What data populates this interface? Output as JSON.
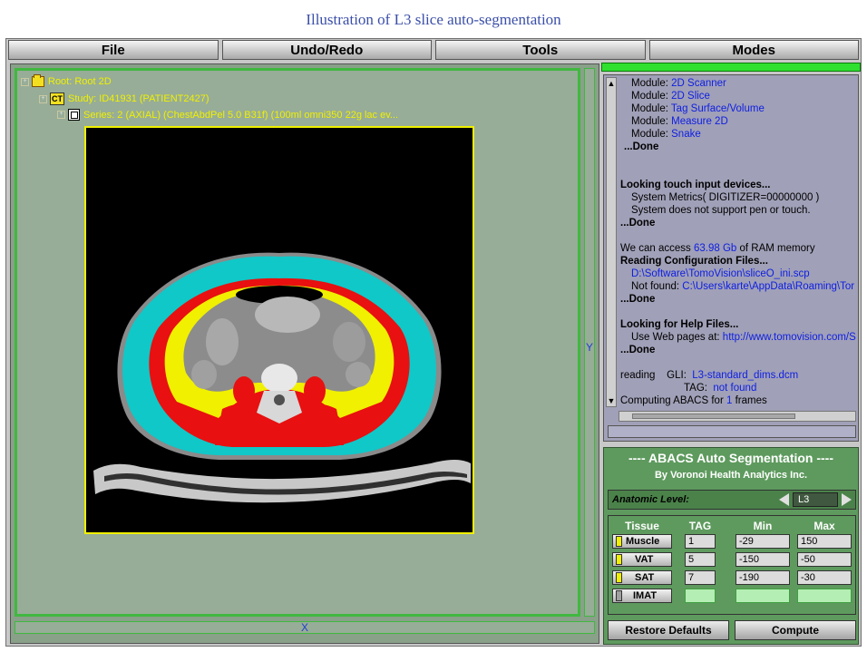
{
  "caption": "Illustration of L3 slice auto-segmentation",
  "menu": {
    "file": "File",
    "undo_redo": "Undo/Redo",
    "tools": "Tools",
    "modes": "Modes"
  },
  "tree": {
    "root": "Root: Root 2D",
    "study": "Study: ID41931 (PATIENT2427)",
    "study_icon": "CT",
    "series": "Series: 2 (AXIAL) (ChestAbdPel  5.0  B31f) (100ml omni350 22g lac ev..."
  },
  "axes": {
    "y": "Y",
    "x": "X"
  },
  "console": {
    "modules": [
      {
        "prefix": "Module:",
        "name": "2D Scanner"
      },
      {
        "prefix": "Module:",
        "name": "2D Slice"
      },
      {
        "prefix": "Module:",
        "name": "Tag Surface/Volume"
      },
      {
        "prefix": "Module:",
        "name": "Measure 2D"
      },
      {
        "prefix": "Module:",
        "name": "Snake"
      }
    ],
    "done": "...Done",
    "touch_header": "Looking touch input devices...",
    "touch_line1": "System Metrics( DIGITIZER=00000000 )",
    "touch_line2": "System does not support pen or touch.",
    "ram_prefix": "We can access",
    "ram_value": "63.98 Gb",
    "ram_suffix": "of RAM memory",
    "config_header": "Reading Configuration Files...",
    "config_path": "D:\\Software\\TomoVision\\sliceO_ini.scp",
    "notfound_prefix": "Not found:",
    "notfound_path": "C:\\Users\\karte\\AppData\\Roaming\\Tor",
    "help_header": "Looking for Help Files...",
    "help_prefix": "Use Web pages at:",
    "help_url": "http://www.tomovision.com/S",
    "reading_label": "reading",
    "gli_label": "GLI:",
    "gli_value": "L3-standard_dims.dcm",
    "tag_label": "TAG:",
    "tag_value": "not found",
    "computing_prefix": "Computing ABACS for",
    "computing_count": "1",
    "computing_suffix": "frames"
  },
  "abacs": {
    "title": "---- ABACS Auto Segmentation ----",
    "subtitle": "By Voronoi Health Analytics Inc.",
    "anatomic_label": "Anatomic Level:",
    "anatomic_value": "L3",
    "headers": {
      "tissue": "Tissue",
      "tag": "TAG",
      "min": "Min",
      "max": "Max"
    },
    "rows": [
      {
        "tissue": "Muscle",
        "tag": "1",
        "min": "-29",
        "max": "150",
        "color": "#f0f000"
      },
      {
        "tissue": "VAT",
        "tag": "5",
        "min": "-150",
        "max": "-50",
        "color": "#f0f000"
      },
      {
        "tissue": "SAT",
        "tag": "7",
        "min": "-190",
        "max": "-30",
        "color": "#f0f000"
      },
      {
        "tissue": "IMAT",
        "tag": "",
        "min": "",
        "max": "",
        "color": "#a0a0a0"
      }
    ],
    "restore_label": "Restore Defaults",
    "compute_label": "Compute"
  },
  "colors": {
    "muscle": "#e81010",
    "vat": "#f0f000",
    "sat": "#10c8c8",
    "accent": "#30e030"
  }
}
